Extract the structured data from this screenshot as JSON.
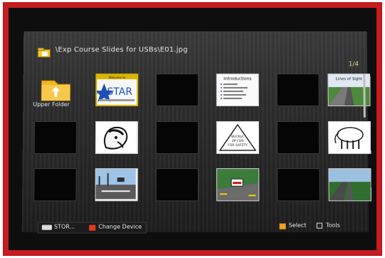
{
  "header": {
    "path": "\\Exp Course Slides for USBs\\E01.jpg",
    "page_counter": "1/4"
  },
  "grid": {
    "folder_label": "Upper Folder",
    "thumbnails": [
      {
        "type": "folder",
        "icon": "folder-up-icon"
      },
      {
        "type": "image",
        "title": "Welcome to",
        "caption": "STAR"
      },
      {
        "type": "empty"
      },
      {
        "type": "image",
        "title": "Introductions",
        "bullets": [
          "Name",
          "Motorcycling experience",
          "Your expectations",
          "Something you want to learn",
          "Nervous/Anxious?"
        ]
      },
      {
        "type": "empty"
      },
      {
        "type": "image",
        "title": "Lines of Sight"
      },
      {
        "type": "empty"
      },
      {
        "type": "image",
        "title": ""
      },
      {
        "type": "empty"
      },
      {
        "type": "image",
        "title": "",
        "lines": [
          "BUCKLE",
          "UP FOR",
          "FOR SAFETY"
        ]
      },
      {
        "type": "empty"
      },
      {
        "type": "image",
        "title": ""
      },
      {
        "type": "empty"
      },
      {
        "type": "image",
        "title": ""
      },
      {
        "type": "empty"
      },
      {
        "type": "image",
        "title": ""
      },
      {
        "type": "empty"
      },
      {
        "type": "image",
        "title": ""
      }
    ]
  },
  "footer": {
    "device_label": "STOR...",
    "change_device": "Change Device",
    "select": "Select",
    "tools": "Tools"
  },
  "colors": {
    "frame_red": "#c3161c",
    "accent_yellow": "#d9b400",
    "change_red": "#e03a1d",
    "select_orange": "#f0a11e"
  }
}
